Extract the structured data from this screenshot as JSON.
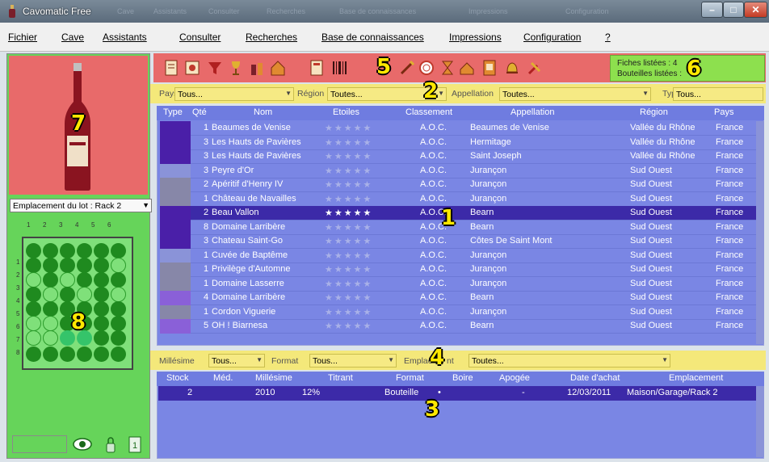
{
  "window": {
    "title": "Cavomatic Free",
    "ghost_menu": [
      "Cave",
      "Assistants",
      "Consulter",
      "Recherches",
      "Base de connaissances",
      "Impressions",
      "Configuration"
    ],
    "buttons": {
      "minimize": "–",
      "maximize": "□",
      "close": "✕"
    }
  },
  "menu": [
    {
      "label": "Fichier"
    },
    {
      "label": "Cave"
    },
    {
      "label": "Assistants"
    },
    {
      "label": "Consulter"
    },
    {
      "label": "Recherches"
    },
    {
      "label": "Base de connaissances"
    },
    {
      "label": "Impressions"
    },
    {
      "label": "Configuration"
    },
    {
      "label": "?"
    }
  ],
  "left": {
    "emplacement_label": "Emplacement du lot : Rack 2",
    "rack_columns": [
      "1",
      "2",
      "3",
      "4",
      "5",
      "6"
    ],
    "rack_rows": [
      "1",
      "2",
      "3",
      "4",
      "5",
      "6",
      "7",
      "8"
    ]
  },
  "status": {
    "fiches": "Fiches listées : 4",
    "bouteilles": "Bouteilles listées : "
  },
  "filters": {
    "pays_label": "Pays",
    "pays_value": "Tous...",
    "region_label": "Région",
    "region_value": "Toutes...",
    "appellation_label": "Appellation",
    "appellation_value": "Toutes...",
    "type_label": "Type",
    "type_value": "Tous..."
  },
  "table": {
    "headers": {
      "type": "Type",
      "qte": "Qté",
      "nom": "Nom",
      "etoiles": "Etoiles",
      "classement": "Classement",
      "appellation": "Appellation",
      "region": "Région",
      "pays": "Pays"
    },
    "rows": [
      {
        "qte": "1",
        "nom": "Beaumes de Venise",
        "stars": "★★★★★",
        "classement": "A.O.C.",
        "appellation": "Beaumes de Venise",
        "region": "Vallée du Rhône",
        "pays": "France",
        "type_color": "#4a1fa8"
      },
      {
        "qte": "3",
        "nom": "Les Hauts de Pavières",
        "stars": "★★★★★",
        "classement": "A.O.C.",
        "appellation": "Hermitage",
        "region": "Vallée du Rhône",
        "pays": "France",
        "type_color": "#4a1fa8"
      },
      {
        "qte": "3",
        "nom": "Les Hauts de Pavières",
        "stars": "★★★★★",
        "classement": "A.O.C.",
        "appellation": "Saint Joseph",
        "region": "Vallée du Rhône",
        "pays": "France",
        "type_color": "#4a1fa8"
      },
      {
        "qte": "3",
        "nom": "Peyre d'Or",
        "stars": "★★★★★",
        "classement": "A.O.C.",
        "appellation": "Jurançon",
        "region": "Sud Ouest",
        "pays": "France",
        "type_color": "#8a93d8"
      },
      {
        "qte": "2",
        "nom": "Apéritif d'Henry IV",
        "stars": "★★★★★",
        "classement": "A.O.C.",
        "appellation": "Jurançon",
        "region": "Sud Ouest",
        "pays": "France",
        "type_color": "#8787a8"
      },
      {
        "qte": "1",
        "nom": "Château de Navailles",
        "stars": "★★★★★",
        "classement": "A.O.C.",
        "appellation": "Jurançon",
        "region": "Sud Ouest",
        "pays": "France",
        "type_color": "#8787a8"
      },
      {
        "qte": "2",
        "nom": "Beau Vallon",
        "stars": "★★★★★",
        "classement": "A.O.C.",
        "appellation": "Bearn",
        "region": "Sud Ouest",
        "pays": "France",
        "type_color": "#4a1fa8",
        "selected": true
      },
      {
        "qte": "8",
        "nom": "Domaine Larribère",
        "stars": "★★★★★",
        "classement": "A.O.C.",
        "appellation": "Bearn",
        "region": "Sud Ouest",
        "pays": "France",
        "type_color": "#4a1fa8"
      },
      {
        "qte": "3",
        "nom": "Chateau Saint-Go",
        "stars": "★★★★★",
        "classement": "A.O.C.",
        "appellation": "Côtes De Saint Mont",
        "region": "Sud Ouest",
        "pays": "France",
        "type_color": "#4a1fa8"
      },
      {
        "qte": "1",
        "nom": "Cuvée de Baptême",
        "stars": "★★★★★",
        "classement": "A.O.C.",
        "appellation": "Jurançon",
        "region": "Sud Ouest",
        "pays": "France",
        "type_color": "#8a93d8"
      },
      {
        "qte": "1",
        "nom": "Privilège d'Automne",
        "stars": "★★★★★",
        "classement": "A.O.C.",
        "appellation": "Jurançon",
        "region": "Sud Ouest",
        "pays": "France",
        "type_color": "#8787a8"
      },
      {
        "qte": "1",
        "nom": "Domaine Lasserre",
        "stars": "★★★★★",
        "classement": "A.O.C.",
        "appellation": "Jurançon",
        "region": "Sud Ouest",
        "pays": "France",
        "type_color": "#8787a8"
      },
      {
        "qte": "4",
        "nom": "Domaine Larribère",
        "stars": "★★★★★",
        "classement": "A.O.C.",
        "appellation": "Bearn",
        "region": "Sud Ouest",
        "pays": "France",
        "type_color": "#8a60d8"
      },
      {
        "qte": "1",
        "nom": "Cordon Viguerie",
        "stars": "★★★★★",
        "classement": "A.O.C.",
        "appellation": "Jurançon",
        "region": "Sud Ouest",
        "pays": "France",
        "type_color": "#8787a8"
      },
      {
        "qte": "5",
        "nom": "OH ! Biarnesa",
        "stars": "★★★★★",
        "classement": "A.O.C.",
        "appellation": "Bearn",
        "region": "Sud Ouest",
        "pays": "France",
        "type_color": "#8a60d8"
      }
    ]
  },
  "filters2": {
    "millesime_label": "Millésime",
    "millesime_value": "Tous...",
    "format_label": "Format",
    "format_value": "Tous...",
    "emplacement_label": "Emplac",
    "emplacement_label_end": "nt",
    "emplacement_value": "Toutes..."
  },
  "subtable": {
    "headers": {
      "stock": "Stock",
      "med": "Méd.",
      "millesime": "Millésime",
      "titrant": "Titrant",
      "format": "Format",
      "boire": "Boire",
      "apogee": "Apogée",
      "date_achat": "Date d'achat",
      "emplacement": "Emplacement"
    },
    "row": {
      "stock": "2",
      "millesime": "2010",
      "titrant": "12%",
      "format": "Bouteille",
      "boire": "•",
      "apogee": "-",
      "date_achat": "12/03/2011",
      "emplacement": "Maison/Garage/Rack 2"
    }
  },
  "annotations": [
    "1",
    "2",
    "3",
    "4",
    "5",
    "6",
    "7",
    "8"
  ]
}
